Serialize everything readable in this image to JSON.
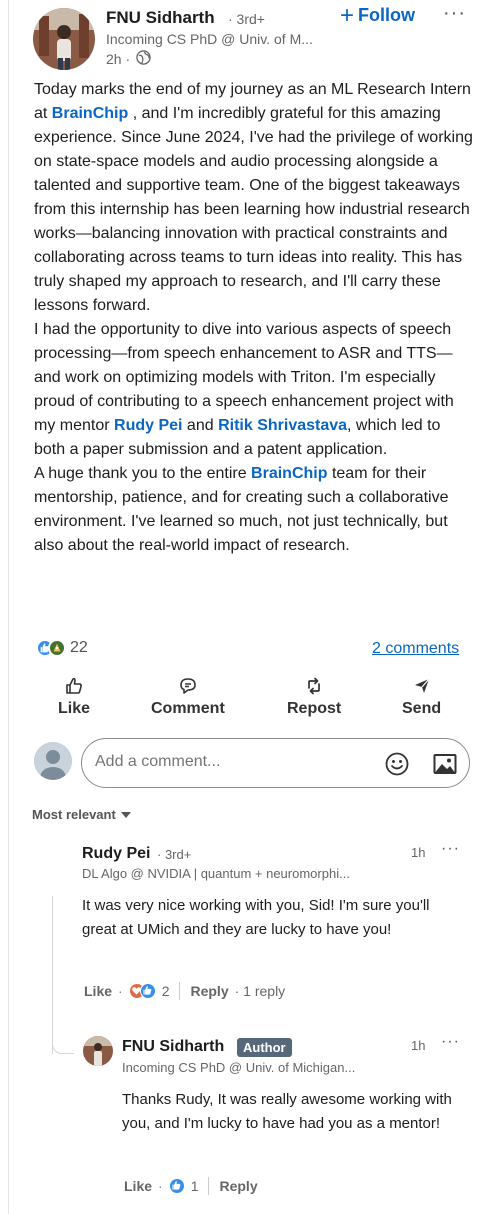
{
  "post": {
    "author_name": "FNU Sidharth",
    "degree": "· 3rd+",
    "headline": "Incoming CS PhD @ Univ. of M...",
    "time": "2h ·",
    "follow_label": "Follow",
    "more": "···",
    "paragraphs": [
      [
        {
          "text": "Today marks the end of my journey as an ML Research Intern at "
        },
        {
          "text": "BrainChip",
          "mention": true
        },
        {
          "text": " , and I'm incredibly grateful for this amazing experience. Since June 2024, I've had the privilege of working on state-space models and audio processing alongside a talented and supportive team. One of the biggest takeaways from this internship has been learning how industrial research works—balancing innovation with practical constraints and collaborating across teams to turn ideas into reality. This has truly shaped my approach to research, and I'll carry these lessons forward."
        }
      ],
      [
        {
          "text": "I had the opportunity to dive into various aspects of speech processing—from speech enhancement to ASR and TTS—and work on optimizing models with Triton. I'm especially proud of contributing to a speech enhancement project with my mentor "
        },
        {
          "text": "Rudy Pei",
          "mention": true
        },
        {
          "text": " and "
        },
        {
          "text": "Ritik Shrivastava",
          "mention": true
        },
        {
          "text": ", which led to both a paper submission and a patent application."
        }
      ],
      [
        {
          "text": "A huge thank you to the entire "
        },
        {
          "text": "BrainChip",
          "mention": true
        },
        {
          "text": " team for their mentorship, patience, and for creating such a collaborative environment. I've learned so much, not just technically, but also about the real-world impact of research."
        }
      ]
    ],
    "reaction_count": "22",
    "comments_link": "2 comments"
  },
  "actions": {
    "like": "Like",
    "comment": "Comment",
    "repost": "Repost",
    "send": "Send"
  },
  "composer": {
    "placeholder": "Add a comment..."
  },
  "sort_label": "Most relevant",
  "comments": [
    {
      "name": "Rudy Pei",
      "degree": "· 3rd+",
      "headline": "DL Algo @ NVIDIA | quantum + neuromorphi...",
      "time": "1h",
      "text": "It was very nice working with you, Sid! I'm sure you'll great at UMich and they are lucky to have you!",
      "like": "Like",
      "reaction_count": "2",
      "reply": "Reply",
      "reply_count": "· 1 reply"
    },
    {
      "name": "FNU Sidharth",
      "badge": "Author",
      "headline": "Incoming CS PhD @ Univ. of Michigan...",
      "time": "1h",
      "text": "Thanks Rudy, It was really awesome working with you, and I'm lucky to have had you as a mentor!",
      "like": "Like",
      "reaction_count": "1",
      "reply": "Reply"
    }
  ],
  "colors": {
    "link_blue": "#0a66c2",
    "author_badge": "#56687a"
  }
}
